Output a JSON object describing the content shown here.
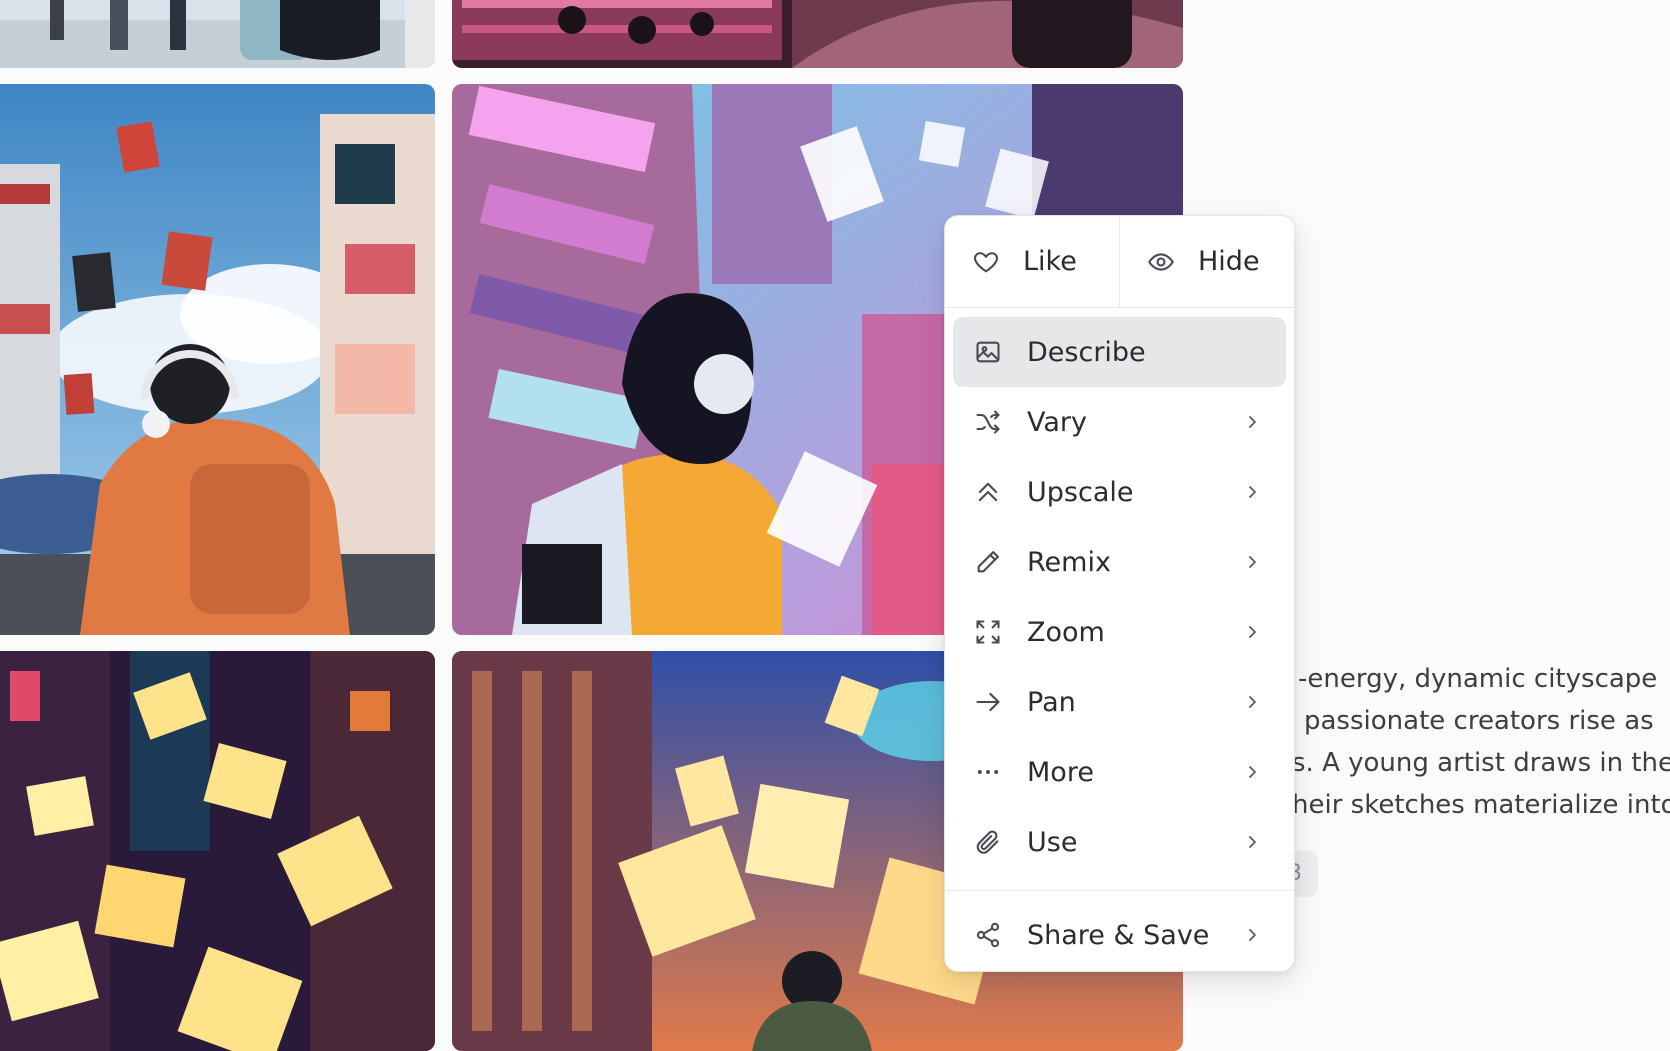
{
  "menu": {
    "like_label": "Like",
    "hide_label": "Hide",
    "items": [
      {
        "label": "Describe",
        "icon": "image-icon",
        "has_submenu": false,
        "active": true
      },
      {
        "label": "Vary",
        "icon": "shuffle-icon",
        "has_submenu": true
      },
      {
        "label": "Upscale",
        "icon": "double-chevron-up-icon",
        "has_submenu": true
      },
      {
        "label": "Remix",
        "icon": "pencil-icon",
        "has_submenu": true
      },
      {
        "label": "Zoom",
        "icon": "zoom-expand-icon",
        "has_submenu": true
      },
      {
        "label": "Pan",
        "icon": "arrow-right-icon",
        "has_submenu": true
      },
      {
        "label": "More",
        "icon": "more-dots-icon",
        "has_submenu": true
      },
      {
        "label": "Use",
        "icon": "paperclip-icon",
        "has_submenu": true
      }
    ],
    "share_label": "Share & Save"
  },
  "description": {
    "lines": [
      "-energy, dynamic cityscape",
      "passionate creators rise as",
      "s. A young artist draws in the",
      "heir sketches materialize into"
    ],
    "chip_text": "3"
  },
  "colors": {
    "menu_background": "#ffffff",
    "active_item_background": "#e7e7ea",
    "text": "#2b2b30"
  }
}
